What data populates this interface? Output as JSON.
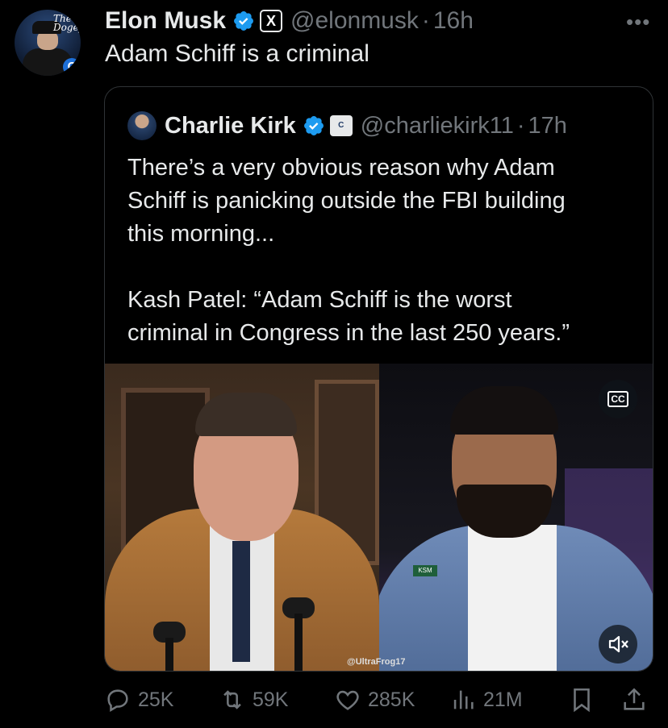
{
  "tweet": {
    "author_name": "Elon Musk",
    "author_handle": "@elonmusk",
    "separator": "·",
    "time": "16h",
    "text": "Adam Schiff is a criminal",
    "affiliate_badge": "X",
    "avatar_text": "The Dogefa"
  },
  "quoted": {
    "author_name": "Charlie Kirk",
    "author_handle": "@charliekirk11",
    "separator": "·",
    "time": "17h",
    "text": "There’s a very obvious reason why Adam\nSchiff is panicking outside the FBI building\nthis morning...\n\nKash Patel: “Adam Schiff is the worst\ncriminal in Congress in the last 250 years.”",
    "media": {
      "cc_label": "CC",
      "watermark": "@UltraFrog17",
      "pin_text": "KSM"
    }
  },
  "actions": {
    "replies": "25K",
    "reposts": "59K",
    "likes": "285K",
    "views": "21M"
  },
  "colors": {
    "background": "#000000",
    "text": "#e7e9ea",
    "secondary": "#71767b",
    "verified": "#1d9bf0"
  }
}
